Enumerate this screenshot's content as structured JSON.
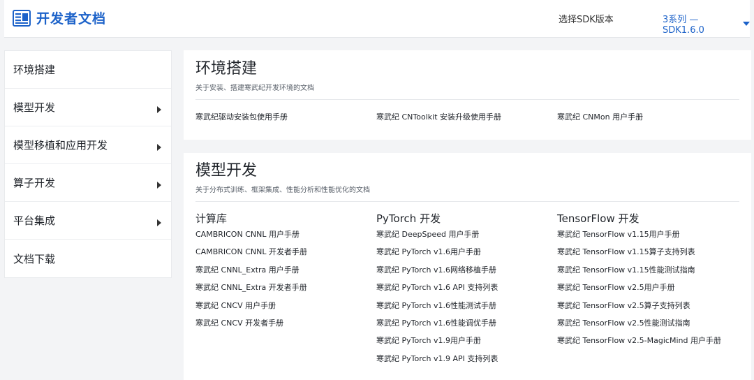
{
  "header": {
    "title": "开发者文档",
    "sdk_label": "选择SDK版本",
    "sdk_version": "3系列 — SDK1.6.0"
  },
  "colors": {
    "brand": "#1c62c9"
  },
  "sidebar": {
    "items": [
      {
        "label": "环境搭建",
        "has_arrow": false
      },
      {
        "label": "模型开发",
        "has_arrow": true
      },
      {
        "label": "模型移植和应用开发",
        "has_arrow": true
      },
      {
        "label": "算子开发",
        "has_arrow": true
      },
      {
        "label": "平台集成",
        "has_arrow": true
      },
      {
        "label": "文档下载",
        "has_arrow": false
      }
    ]
  },
  "env": {
    "title": "环境搭建",
    "desc": "关于安装、搭建寒武纪开发环境的文档",
    "links": [
      "寒武纪驱动安装包使用手册",
      "寒武纪 CNToolkit 安装升级使用手册",
      "寒武纪 CNMon 用户手册"
    ]
  },
  "model": {
    "title": "模型开发",
    "desc": "关于分布式训练、框架集成、性能分析和性能优化的文档",
    "columns": [
      {
        "heading": "计算库",
        "links": [
          "CAMBRICON CNNL 用户手册",
          "CAMBRICON CNNL 开发者手册",
          "寒武纪 CNNL_Extra 用户手册",
          "寒武纪 CNNL_Extra 开发者手册",
          "寒武纪 CNCV 用户手册",
          "寒武纪 CNCV 开发者手册"
        ]
      },
      {
        "heading": "PyTorch 开发",
        "links": [
          "寒武纪 DeepSpeed 用户手册",
          "寒武纪 PyTorch v1.6用户手册",
          "寒武纪 PyTorch v1.6网络移植手册",
          "寒武纪 PyTorch v1.6 API 支持列表",
          "寒武纪 PyTorch v1.6性能测试手册",
          "寒武纪 PyTorch v1.6性能调优手册",
          "寒武纪 PyTorch v1.9用户手册",
          "寒武纪 PyTorch v1.9 API 支持列表"
        ]
      },
      {
        "heading": "TensorFlow 开发",
        "links": [
          "寒武纪 TensorFlow v1.15用户手册",
          "寒武纪 TensorFlow v1.15算子支持列表",
          "寒武纪 TensorFlow v1.15性能测试指南",
          "寒武纪 TensorFlow v2.5用户手册",
          "寒武纪 TensorFlow v2.5算子支持列表",
          "寒武纪 TensorFlow v2.5性能测试指南",
          "寒武纪 TensorFlow v2.5-MagicMind 用户手册"
        ]
      }
    ]
  }
}
